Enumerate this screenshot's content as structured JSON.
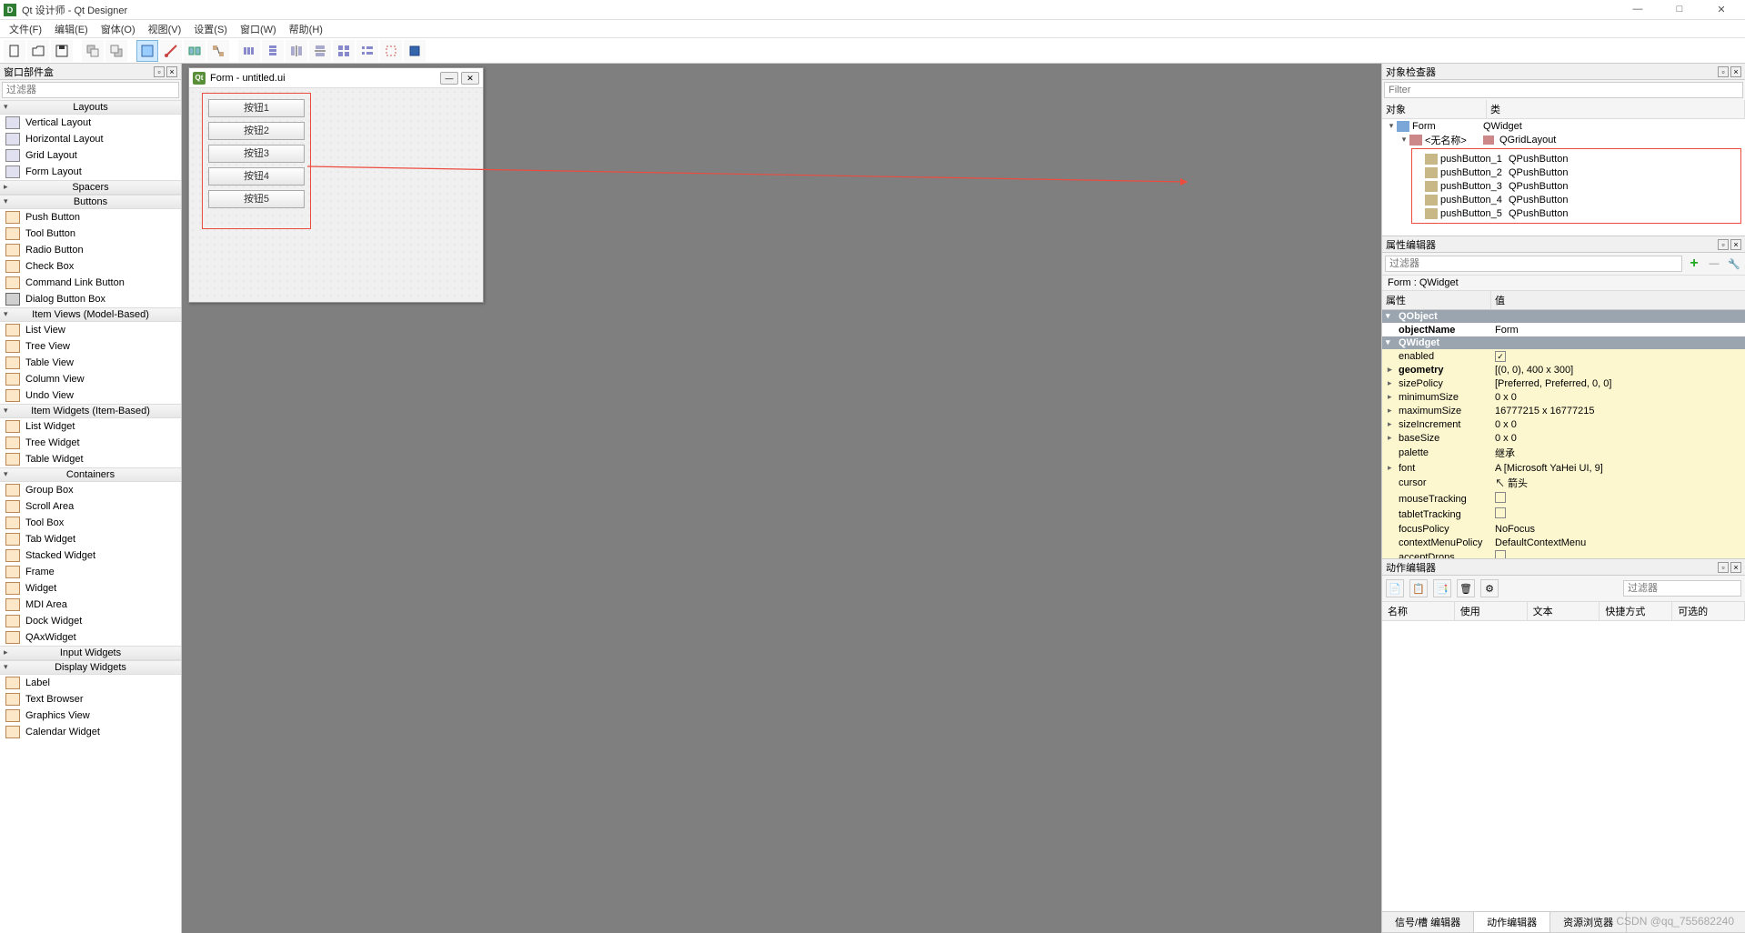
{
  "title": "Qt 设计师 - Qt Designer",
  "menus": [
    "文件(F)",
    "编辑(E)",
    "窗体(O)",
    "视图(V)",
    "设置(S)",
    "窗口(W)",
    "帮助(H)"
  ],
  "widgetBox": {
    "title": "窗口部件盒",
    "filter_placeholder": "过滤器",
    "categories": [
      {
        "name": "Layouts",
        "open": true,
        "items": [
          "Vertical Layout",
          "Horizontal Layout",
          "Grid Layout",
          "Form Layout"
        ]
      },
      {
        "name": "Spacers",
        "open": false,
        "items": []
      },
      {
        "name": "Buttons",
        "open": true,
        "items": [
          "Push Button",
          "Tool Button",
          "Radio Button",
          "Check Box",
          "Command Link Button",
          "Dialog Button Box"
        ]
      },
      {
        "name": "Item Views (Model-Based)",
        "open": true,
        "items": [
          "List View",
          "Tree View",
          "Table View",
          "Column View",
          "Undo View"
        ]
      },
      {
        "name": "Item Widgets (Item-Based)",
        "open": true,
        "items": [
          "List Widget",
          "Tree Widget",
          "Table Widget"
        ]
      },
      {
        "name": "Containers",
        "open": true,
        "items": [
          "Group Box",
          "Scroll Area",
          "Tool Box",
          "Tab Widget",
          "Stacked Widget",
          "Frame",
          "Widget",
          "MDI Area",
          "Dock Widget",
          "QAxWidget"
        ]
      },
      {
        "name": "Input Widgets",
        "open": false,
        "items": []
      },
      {
        "name": "Display Widgets",
        "open": true,
        "items": [
          "Label",
          "Text Browser",
          "Graphics View",
          "Calendar Widget"
        ]
      }
    ]
  },
  "form": {
    "title": "Form - untitled.ui",
    "buttons": [
      "按钮1",
      "按钮2",
      "按钮3",
      "按钮4",
      "按钮5"
    ]
  },
  "inspector": {
    "title": "对象检查器",
    "filter_placeholder": "Filter",
    "headers": [
      "对象",
      "类"
    ],
    "root": {
      "name": "Form",
      "class": "QWidget"
    },
    "layout": {
      "name": "<无名称>",
      "class": "QGridLayout"
    },
    "children": [
      {
        "name": "pushButton_1",
        "class": "QPushButton"
      },
      {
        "name": "pushButton_2",
        "class": "QPushButton"
      },
      {
        "name": "pushButton_3",
        "class": "QPushButton"
      },
      {
        "name": "pushButton_4",
        "class": "QPushButton"
      },
      {
        "name": "pushButton_5",
        "class": "QPushButton"
      }
    ]
  },
  "properties": {
    "title": "属性编辑器",
    "filter_placeholder": "过滤器",
    "path": "Form : QWidget",
    "headers": [
      "属性",
      "值"
    ],
    "groups": [
      {
        "name": "QObject",
        "rows": [
          {
            "k": "objectName",
            "v": "Form",
            "bold": true
          }
        ]
      },
      {
        "name": "QWidget",
        "rows": [
          {
            "k": "enabled",
            "v": "",
            "check": true,
            "checked": true,
            "yellow": true
          },
          {
            "k": "geometry",
            "v": "[(0, 0), 400 x 300]",
            "exp": true,
            "bold": true,
            "yellow": true
          },
          {
            "k": "sizePolicy",
            "v": "[Preferred, Preferred, 0, 0]",
            "exp": true,
            "yellow": true
          },
          {
            "k": "minimumSize",
            "v": "0 x 0",
            "exp": true,
            "yellow": true
          },
          {
            "k": "maximumSize",
            "v": "16777215 x 16777215",
            "exp": true,
            "yellow": true
          },
          {
            "k": "sizeIncrement",
            "v": "0 x 0",
            "exp": true,
            "yellow": true
          },
          {
            "k": "baseSize",
            "v": "0 x 0",
            "exp": true,
            "yellow": true
          },
          {
            "k": "palette",
            "v": "继承",
            "yellow": true
          },
          {
            "k": "font",
            "v": "A  [Microsoft YaHei UI, 9]",
            "exp": true,
            "yellow": true
          },
          {
            "k": "cursor",
            "v": "↖ 箭头",
            "yellow": true
          },
          {
            "k": "mouseTracking",
            "v": "",
            "check": true,
            "checked": false,
            "yellow": true
          },
          {
            "k": "tabletTracking",
            "v": "",
            "check": true,
            "checked": false,
            "yellow": true
          },
          {
            "k": "focusPolicy",
            "v": "NoFocus",
            "yellow": true
          },
          {
            "k": "contextMenuPolicy",
            "v": "DefaultContextMenu",
            "yellow": true
          },
          {
            "k": "acceptDrops",
            "v": "",
            "check": true,
            "checked": false,
            "yellow": true
          }
        ]
      }
    ]
  },
  "actions": {
    "title": "动作编辑器",
    "filter_placeholder": "过滤器",
    "headers": [
      "名称",
      "使用",
      "文本",
      "快捷方式",
      "可选的"
    ]
  },
  "bottomTabs": [
    "信号/槽 编辑器",
    "动作编辑器",
    "资源浏览器"
  ],
  "watermark": "CSDN @qq_755682240"
}
